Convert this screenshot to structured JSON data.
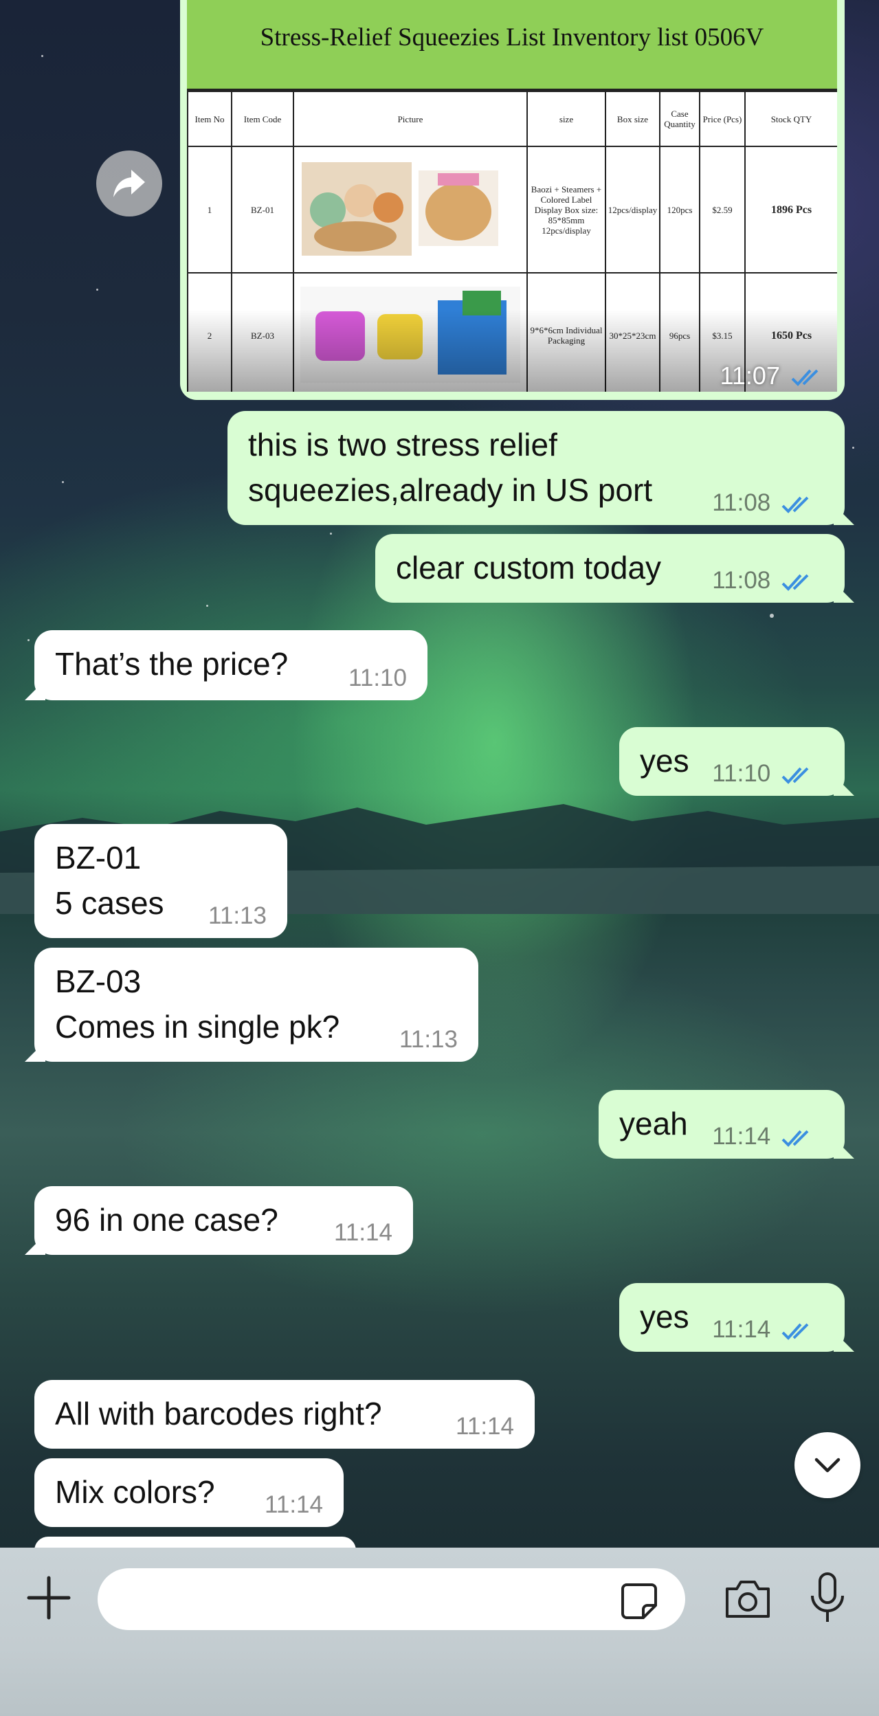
{
  "image_message": {
    "sheet_title": "Stress-Relief Squeezies List Inventory list 0506V",
    "headers": [
      "Item No",
      "Item Code",
      "Picture",
      "size",
      "Box size",
      "Case Quantity",
      "Price (Pcs)",
      "Stock QTY"
    ],
    "rows": [
      {
        "no": "1",
        "code": "BZ-01",
        "size": "Baozi + Steamers + Colored Label Display Box size: 85*85mm 12pcs/display",
        "box": "12pcs/display",
        "case": "120pcs",
        "price": "$2.59",
        "stock": "1896 Pcs"
      },
      {
        "no": "2",
        "code": "BZ-03",
        "size": "9*6*6cm Individual Packaging",
        "box": "30*25*23cm",
        "case": "96pcs",
        "price": "$3.15",
        "stock": "1650 Pcs"
      }
    ],
    "time": "11:07"
  },
  "messages": [
    {
      "id": "m1",
      "direction": "out",
      "text": "this is two stress relief squeezies,already in US port",
      "time": "11:08",
      "status": "read"
    },
    {
      "id": "m2",
      "direction": "out",
      "text": "clear custom today",
      "time": "11:08",
      "status": "read"
    },
    {
      "id": "m3",
      "direction": "in",
      "text": "That’s the price?",
      "time": "11:10"
    },
    {
      "id": "m4",
      "direction": "out",
      "text": "yes",
      "time": "11:10",
      "status": "read"
    },
    {
      "id": "m5",
      "direction": "in",
      "line1": "BZ-01",
      "line2": "5 cases",
      "time": "11:13"
    },
    {
      "id": "m6",
      "direction": "in",
      "line1": "BZ-03",
      "line2": "Comes in single pk?",
      "time": "11:13"
    },
    {
      "id": "m7",
      "direction": "out",
      "text": "yeah",
      "time": "11:14",
      "status": "read"
    },
    {
      "id": "m8",
      "direction": "in",
      "text": "96 in one case?",
      "time": "11:14"
    },
    {
      "id": "m9",
      "direction": "out",
      "text": "yes",
      "time": "11:14",
      "status": "read"
    },
    {
      "id": "m10",
      "direction": "in",
      "text": "All with barcodes right?",
      "time": "11:14"
    },
    {
      "id": "m11",
      "direction": "in",
      "text": "Mix colors?",
      "time": "11:14"
    }
  ],
  "colors": {
    "outgoing": "#d9fdd3",
    "incoming": "#ffffff",
    "read_ticks": "#3b8fe0"
  },
  "composer": {
    "input_value": ""
  }
}
